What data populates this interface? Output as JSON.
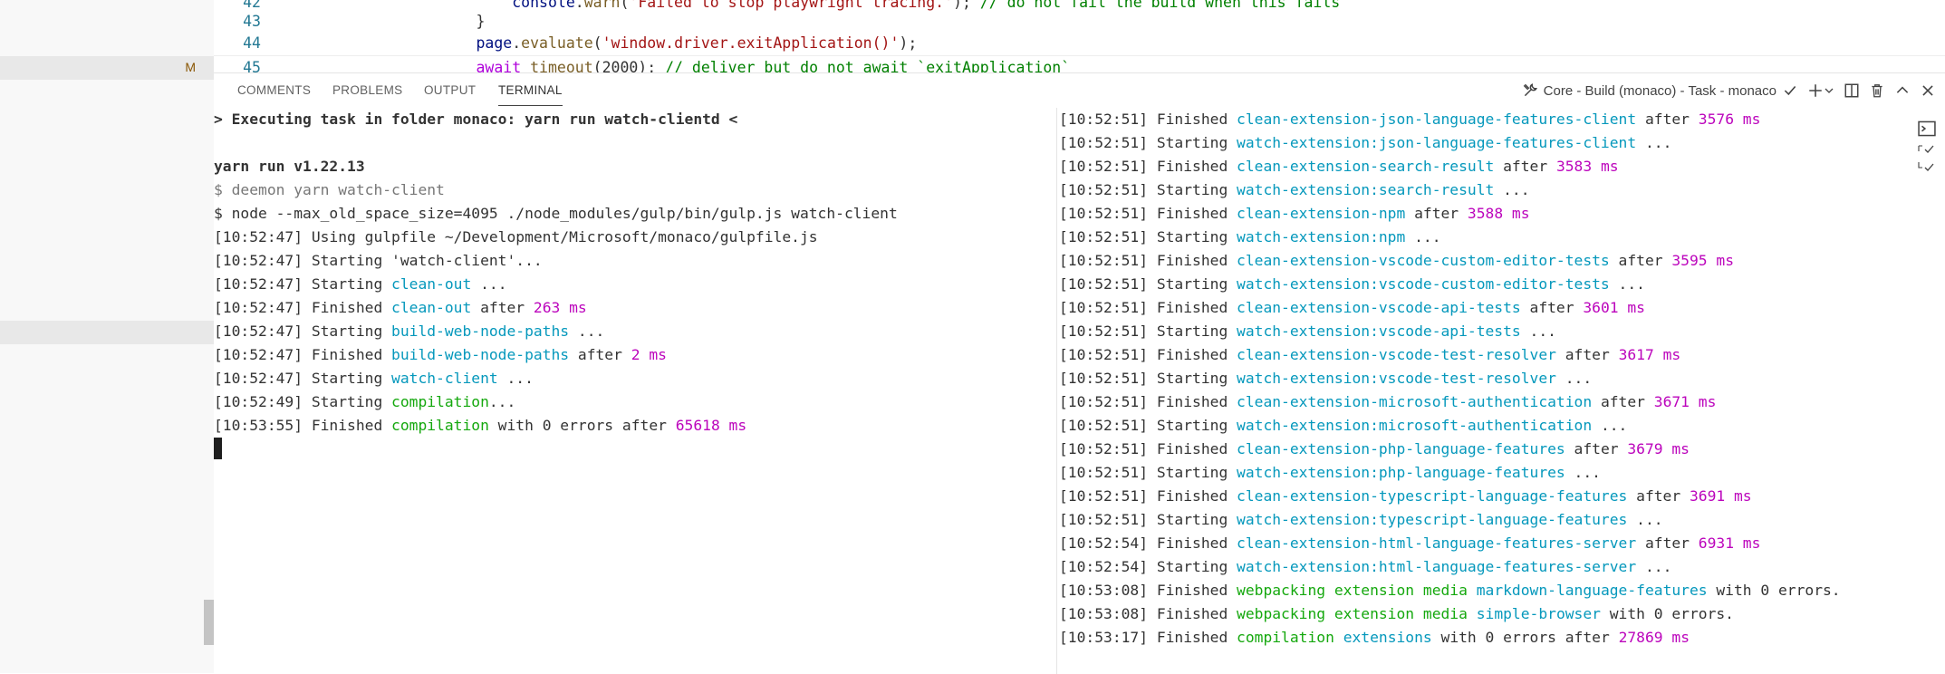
{
  "editor": {
    "lines": [
      {
        "num": "42",
        "indent": "            ",
        "parts": [
          {
            "t": "console",
            "c": "k-var"
          },
          {
            "t": "."
          },
          {
            "t": "warn",
            "c": "k-fn"
          },
          {
            "t": "("
          },
          {
            "t": "'Failed to stop playwright tracing.'",
            "c": "k-str"
          },
          {
            "t": "); "
          },
          {
            "t": "// do not fail the build when this fails",
            "c": "k-com"
          }
        ]
      },
      {
        "num": "43",
        "indent": "        ",
        "parts": [
          {
            "t": "}"
          }
        ]
      },
      {
        "num": "44",
        "indent": "        ",
        "parts": [
          {
            "t": "page",
            "c": "k-var"
          },
          {
            "t": "."
          },
          {
            "t": "evaluate",
            "c": "k-fn"
          },
          {
            "t": "("
          },
          {
            "t": "'window.driver.exitApplication()'",
            "c": "k-str"
          },
          {
            "t": ");"
          }
        ]
      },
      {
        "num": "45",
        "indent": "        ",
        "parts": [
          {
            "t": "await ",
            "c": "k-kw"
          },
          {
            "t": "timeout",
            "c": "k-fn"
          },
          {
            "t": "(2000); "
          },
          {
            "t": "// deliver but do not await `exitApplication`",
            "c": "k-com"
          }
        ]
      }
    ]
  },
  "sidebar": {
    "modified_badge": "M"
  },
  "panel": {
    "tabs": [
      "COMMENTS",
      "PROBLEMS",
      "OUTPUT",
      "TERMINAL"
    ],
    "active_tab": "TERMINAL",
    "task_label": "Core - Build (monaco) - Task - monaco"
  },
  "terminal_left": [
    [
      {
        "t": "> Executing task in folder monaco: yarn run watch-clientd <",
        "c": "bold"
      }
    ],
    [
      {
        "t": ""
      }
    ],
    [
      {
        "t": "yarn run v1.22.13",
        "c": "bold"
      }
    ],
    [
      {
        "t": "$ deemon yarn watch-client",
        "c": "t-dim"
      }
    ],
    [
      {
        "t": "$ node --max_old_space_size=4095 ./node_modules/gulp/bin/gulp.js watch-client"
      }
    ],
    [
      {
        "t": "[10:52:47] Using gulpfile ~/Development/Microsoft/monaco/gulpfile.js"
      }
    ],
    [
      {
        "t": "[10:52:47] Starting 'watch-client'..."
      }
    ],
    [
      {
        "t": "[10:52:47] Starting "
      },
      {
        "t": "clean-out",
        "c": "t-cyan"
      },
      {
        "t": " ..."
      }
    ],
    [
      {
        "t": "[10:52:47] Finished "
      },
      {
        "t": "clean-out",
        "c": "t-cyan"
      },
      {
        "t": " after "
      },
      {
        "t": "263 ms",
        "c": "t-mag"
      }
    ],
    [
      {
        "t": "[10:52:47] Starting "
      },
      {
        "t": "build-web-node-paths",
        "c": "t-cyan"
      },
      {
        "t": " ..."
      }
    ],
    [
      {
        "t": "[10:52:47] Finished "
      },
      {
        "t": "build-web-node-paths",
        "c": "t-cyan"
      },
      {
        "t": " after "
      },
      {
        "t": "2 ms",
        "c": "t-mag"
      }
    ],
    [
      {
        "t": "[10:52:47] Starting "
      },
      {
        "t": "watch-client",
        "c": "t-cyan"
      },
      {
        "t": " ..."
      }
    ],
    [
      {
        "t": "[10:52:49] Starting "
      },
      {
        "t": "compilation",
        "c": "t-green"
      },
      {
        "t": "..."
      }
    ],
    [
      {
        "t": "[10:53:55] Finished "
      },
      {
        "t": "compilation",
        "c": "t-green"
      },
      {
        "t": " with 0 errors after "
      },
      {
        "t": "65618 ms",
        "c": "t-mag"
      }
    ]
  ],
  "terminal_right": [
    [
      {
        "t": "[10:52:51] Finished "
      },
      {
        "t": "clean-extension-json-language-features-client",
        "c": "t-cyan"
      },
      {
        "t": " after "
      },
      {
        "t": "3576 ms",
        "c": "t-mag"
      }
    ],
    [
      {
        "t": "[10:52:51] Starting "
      },
      {
        "t": "watch-extension:json-language-features-client",
        "c": "t-cyan"
      },
      {
        "t": " ..."
      }
    ],
    [
      {
        "t": "[10:52:51] Finished "
      },
      {
        "t": "clean-extension-search-result",
        "c": "t-cyan"
      },
      {
        "t": " after "
      },
      {
        "t": "3583 ms",
        "c": "t-mag"
      }
    ],
    [
      {
        "t": "[10:52:51] Starting "
      },
      {
        "t": "watch-extension:search-result",
        "c": "t-cyan"
      },
      {
        "t": " ..."
      }
    ],
    [
      {
        "t": "[10:52:51] Finished "
      },
      {
        "t": "clean-extension-npm",
        "c": "t-cyan"
      },
      {
        "t": " after "
      },
      {
        "t": "3588 ms",
        "c": "t-mag"
      }
    ],
    [
      {
        "t": "[10:52:51] Starting "
      },
      {
        "t": "watch-extension:npm",
        "c": "t-cyan"
      },
      {
        "t": " ..."
      }
    ],
    [
      {
        "t": "[10:52:51] Finished "
      },
      {
        "t": "clean-extension-vscode-custom-editor-tests",
        "c": "t-cyan"
      },
      {
        "t": " after "
      },
      {
        "t": "3595 ms",
        "c": "t-mag"
      }
    ],
    [
      {
        "t": "[10:52:51] Starting "
      },
      {
        "t": "watch-extension:vscode-custom-editor-tests",
        "c": "t-cyan"
      },
      {
        "t": " ..."
      }
    ],
    [
      {
        "t": "[10:52:51] Finished "
      },
      {
        "t": "clean-extension-vscode-api-tests",
        "c": "t-cyan"
      },
      {
        "t": " after "
      },
      {
        "t": "3601 ms",
        "c": "t-mag"
      }
    ],
    [
      {
        "t": "[10:52:51] Starting "
      },
      {
        "t": "watch-extension:vscode-api-tests",
        "c": "t-cyan"
      },
      {
        "t": " ..."
      }
    ],
    [
      {
        "t": "[10:52:51] Finished "
      },
      {
        "t": "clean-extension-vscode-test-resolver",
        "c": "t-cyan"
      },
      {
        "t": " after "
      },
      {
        "t": "3617 ms",
        "c": "t-mag"
      }
    ],
    [
      {
        "t": "[10:52:51] Starting "
      },
      {
        "t": "watch-extension:vscode-test-resolver",
        "c": "t-cyan"
      },
      {
        "t": " ..."
      }
    ],
    [
      {
        "t": "[10:52:51] Finished "
      },
      {
        "t": "clean-extension-microsoft-authentication",
        "c": "t-cyan"
      },
      {
        "t": " after "
      },
      {
        "t": "3671 ms",
        "c": "t-mag"
      }
    ],
    [
      {
        "t": "[10:52:51] Starting "
      },
      {
        "t": "watch-extension:microsoft-authentication",
        "c": "t-cyan"
      },
      {
        "t": " ..."
      }
    ],
    [
      {
        "t": "[10:52:51] Finished "
      },
      {
        "t": "clean-extension-php-language-features",
        "c": "t-cyan"
      },
      {
        "t": " after "
      },
      {
        "t": "3679 ms",
        "c": "t-mag"
      }
    ],
    [
      {
        "t": "[10:52:51] Starting "
      },
      {
        "t": "watch-extension:php-language-features",
        "c": "t-cyan"
      },
      {
        "t": " ..."
      }
    ],
    [
      {
        "t": "[10:52:51] Finished "
      },
      {
        "t": "clean-extension-typescript-language-features",
        "c": "t-cyan"
      },
      {
        "t": " after "
      },
      {
        "t": "3691 ms",
        "c": "t-mag"
      }
    ],
    [
      {
        "t": "[10:52:51] Starting "
      },
      {
        "t": "watch-extension:typescript-language-features",
        "c": "t-cyan"
      },
      {
        "t": " ..."
      }
    ],
    [
      {
        "t": "[10:52:54] Finished "
      },
      {
        "t": "clean-extension-html-language-features-server",
        "c": "t-cyan"
      },
      {
        "t": " after "
      },
      {
        "t": "6931 ms",
        "c": "t-mag"
      }
    ],
    [
      {
        "t": "[10:52:54] Starting "
      },
      {
        "t": "watch-extension:html-language-features-server",
        "c": "t-cyan"
      },
      {
        "t": " ..."
      }
    ],
    [
      {
        "t": "[10:53:08] Finished "
      },
      {
        "t": "webpacking extension media",
        "c": "t-green"
      },
      {
        "t": " "
      },
      {
        "t": "markdown-language-features",
        "c": "t-cyan"
      },
      {
        "t": " with 0 errors."
      }
    ],
    [
      {
        "t": "[10:53:08] Finished "
      },
      {
        "t": "webpacking extension media",
        "c": "t-green"
      },
      {
        "t": " "
      },
      {
        "t": "simple-browser",
        "c": "t-cyan"
      },
      {
        "t": " with 0 errors."
      }
    ],
    [
      {
        "t": "[10:53:17] Finished "
      },
      {
        "t": "compilation",
        "c": "t-green"
      },
      {
        "t": " "
      },
      {
        "t": "extensions",
        "c": "t-cyan"
      },
      {
        "t": " with 0 errors after "
      },
      {
        "t": "27869 ms",
        "c": "t-mag"
      }
    ]
  ]
}
